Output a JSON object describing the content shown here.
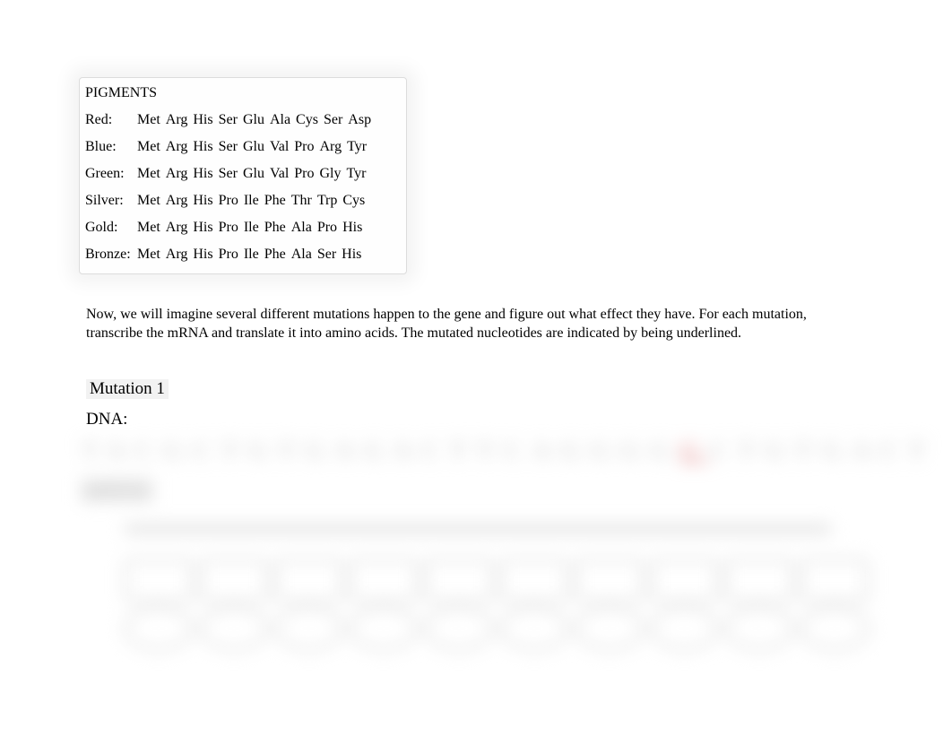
{
  "pigments": {
    "title": "PIGMENTS",
    "rows": [
      {
        "label": "Red:",
        "seq": [
          "Met",
          "Arg",
          "His",
          "Ser",
          "Glu",
          "Ala",
          "Cys",
          "Ser",
          "Asp"
        ]
      },
      {
        "label": "Blue:",
        "seq": [
          "Met",
          "Arg",
          "His",
          "Ser",
          "Glu",
          "Val",
          "Pro",
          "Arg",
          "Tyr"
        ]
      },
      {
        "label": "Green:",
        "seq": [
          "Met",
          "Arg",
          "His",
          "Ser",
          "Glu",
          "Val",
          "Pro",
          "Gly",
          "Tyr"
        ]
      },
      {
        "label": "Silver:",
        "seq": [
          "Met",
          "Arg",
          "His",
          "Pro",
          "Ile",
          "Phe",
          "Thr",
          "Trp",
          "Cys"
        ]
      },
      {
        "label": "Gold:",
        "seq": [
          "Met",
          "Arg",
          "His",
          "Pro",
          "Ile",
          "Phe",
          "Ala",
          "Pro",
          "His"
        ]
      },
      {
        "label": "Bronze:",
        "seq": [
          "Met",
          "Arg",
          "His",
          "Pro",
          "Ile",
          "Phe",
          "Ala",
          "Ser",
          "His"
        ]
      }
    ]
  },
  "instruction": "Now, we will imagine several different mutations happen to the gene and figure out what effect they have. For each mutation, transcribe the mRNA and translate it into amino acids. The mutated nucleotides are indicated by being underlined.",
  "mutation1": {
    "heading": "Mutation 1",
    "dna_label": "DNA:",
    "dna_before": "TACGCTGTGAGACTTCAGGGG",
    "dna_mut": "G",
    "dna_after": "CTGTGACT",
    "mrna_label": "mRNA:"
  }
}
